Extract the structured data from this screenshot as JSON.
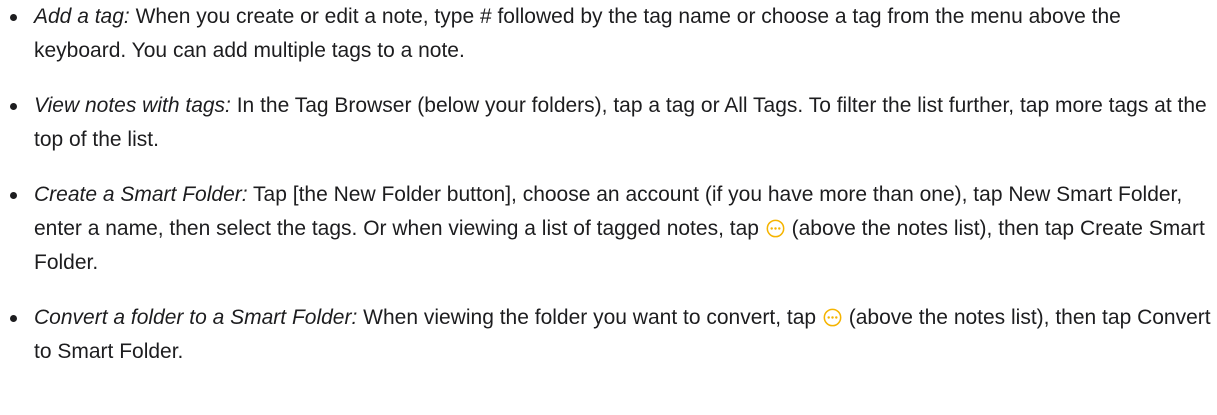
{
  "colors": {
    "text": "#1d1d1f",
    "accent": "#f5b400"
  },
  "items": [
    {
      "term": "Add a tag:",
      "text": " When you create or edit a note, type # followed by the tag name or choose a tag from the menu above the keyboard. You can add multiple tags to a note."
    },
    {
      "term": "View notes with tags:",
      "text": " In the Tag Browser (below your folders), tap a tag or All Tags. To filter the list further, tap more tags at the top of the list."
    },
    {
      "term": "Create a Smart Folder:",
      "text_before_icon": " Tap [the New Folder button], choose an account (if you have more than one), tap New Smart Folder, enter a name, then select the tags. Or when viewing a list of tagged notes, tap ",
      "icon": "more-options-icon",
      "text_after_icon": " (above the notes list), then tap Create Smart Folder."
    },
    {
      "term": "Convert a folder to a Smart Folder:",
      "text_before_icon": " When viewing the folder you want to convert, tap ",
      "icon": "more-options-icon",
      "text_after_icon": " (above the notes list), then tap Convert to Smart Folder."
    }
  ]
}
